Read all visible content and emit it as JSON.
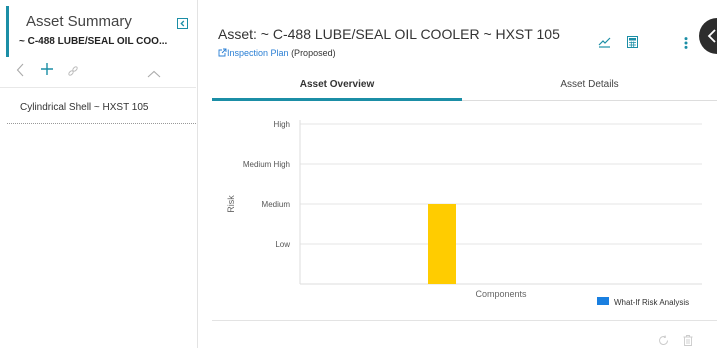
{
  "sidebar": {
    "title": "Asset Summary",
    "subtitle": "~ C-488 LUBE/SEAL OIL COO...",
    "tree_item": "Cylindrical Shell ~ HXST 105",
    "icons": [
      "collapse-icon",
      "back-chevron-icon",
      "plus-icon",
      "link-icon",
      "chevron-up-icon"
    ]
  },
  "header": {
    "title": "Asset: ~ C-488 LUBE/SEAL OIL COOLER ~ HXST 105",
    "plan_link": "Inspection Plan",
    "plan_status": "(Proposed)",
    "icons": [
      "risk-matrix-icon",
      "calculator-icon",
      "more-vert-icon",
      "corner-action-icon"
    ]
  },
  "tabs": [
    {
      "label": "Asset Overview",
      "active": true
    },
    {
      "label": "Asset Details",
      "active": false
    }
  ],
  "colors": {
    "accent": "#1b8ea6",
    "bar": "#ffcc00",
    "legend": "#1a7fe0",
    "link": "#2a7fd4"
  },
  "chart_data": {
    "type": "bar",
    "categories": [
      ""
    ],
    "values": [
      2
    ],
    "y_tick_labels": [
      "Low",
      "Medium",
      "Medium High",
      "High"
    ],
    "ylim": [
      0,
      4
    ],
    "ylabel": "Risk",
    "xlabel": "Components",
    "series": [
      {
        "name": "What-If Risk Analysis",
        "values": [
          2
        ]
      }
    ],
    "legend_position": "bottom-right",
    "grid": true
  },
  "footer": {
    "icons": [
      "refresh-icon",
      "delete-icon"
    ]
  }
}
